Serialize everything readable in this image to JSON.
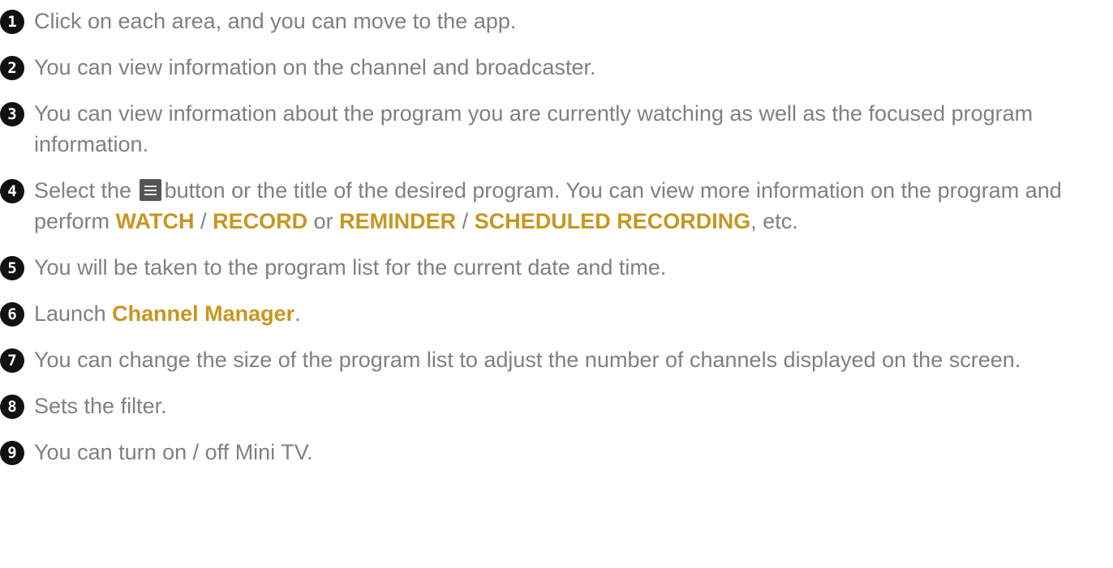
{
  "items": [
    {
      "num": "1",
      "text": "Click on each area, and you can move to the app."
    },
    {
      "num": "2",
      "text": "You can view information on the channel and broadcaster."
    },
    {
      "num": "3",
      "text": "You can view information about the program you are currently watching as well as the focused program information."
    },
    {
      "num": "4",
      "t1": "Select the",
      "t2": "button or the title of the desired program. You can view more information on the program and perform",
      "watch": "WATCH",
      "slash1": "/",
      "record": "RECORD",
      "or": "or",
      "reminder": "REMINDER",
      "slash2": "/",
      "scheduled": "SCHEDULED RECORDING",
      "etc": ", etc.",
      "icon": "menu-lines-icon"
    },
    {
      "num": "5",
      "text": "You will be taken to the program list for the current date and time."
    },
    {
      "num": "6",
      "t1": "Launch",
      "link": "Channel Manager",
      "end": "."
    },
    {
      "num": "7",
      "text": "You can change the size of the program list to adjust the number of channels displayed on the screen."
    },
    {
      "num": "8",
      "text": "Sets the filter."
    },
    {
      "num": "9",
      "text": "You can turn on / off Mini TV."
    }
  ],
  "colors": {
    "body_text": "#808080",
    "highlight": "#c8961e",
    "badge": "#111111"
  }
}
